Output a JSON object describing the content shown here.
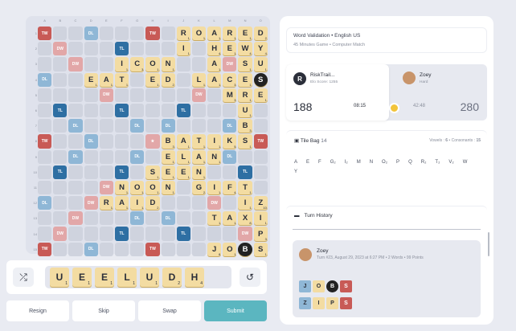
{
  "board": {
    "columns": [
      "A",
      "B",
      "C",
      "D",
      "E",
      "F",
      "G",
      "H",
      "I",
      "J",
      "K",
      "L",
      "M",
      "N",
      "O"
    ],
    "rows": [
      "1",
      "2",
      "3",
      "4",
      "5",
      "6",
      "7",
      "8",
      "9",
      "10",
      "11",
      "12",
      "13",
      "14",
      "15"
    ],
    "premium_labels": {
      "tw": "TW",
      "dw": "DW",
      "tl": "TL",
      "dl": "DL"
    },
    "tiles": [
      {
        "r": 0,
        "c": 9,
        "l": "R",
        "p": "1"
      },
      {
        "r": 0,
        "c": 10,
        "l": "O",
        "p": "1"
      },
      {
        "r": 0,
        "c": 11,
        "l": "A",
        "p": "1"
      },
      {
        "r": 0,
        "c": 12,
        "l": "R",
        "p": "1"
      },
      {
        "r": 0,
        "c": 13,
        "l": "E",
        "p": "1"
      },
      {
        "r": 0,
        "c": 14,
        "l": "D",
        "p": "2"
      },
      {
        "r": 1,
        "c": 9,
        "l": "I",
        "p": "1"
      },
      {
        "r": 1,
        "c": 11,
        "l": "H",
        "p": "4"
      },
      {
        "r": 1,
        "c": 12,
        "l": "E",
        "p": "1"
      },
      {
        "r": 1,
        "c": 13,
        "l": "W",
        "p": "4"
      },
      {
        "r": 1,
        "c": 14,
        "l": "Y",
        "p": "4"
      },
      {
        "r": 2,
        "c": 5,
        "l": "I",
        "p": "1"
      },
      {
        "r": 2,
        "c": 6,
        "l": "C",
        "p": "3"
      },
      {
        "r": 2,
        "c": 7,
        "l": "O",
        "p": "1"
      },
      {
        "r": 2,
        "c": 8,
        "l": "N",
        "p": "1"
      },
      {
        "r": 2,
        "c": 11,
        "l": "A",
        "p": "1"
      },
      {
        "r": 2,
        "c": 13,
        "l": "S",
        "p": "1"
      },
      {
        "r": 2,
        "c": 14,
        "l": "U",
        "p": "1"
      },
      {
        "r": 3,
        "c": 3,
        "l": "E",
        "p": "1"
      },
      {
        "r": 3,
        "c": 4,
        "l": "A",
        "p": "1"
      },
      {
        "r": 3,
        "c": 5,
        "l": "T",
        "p": "1"
      },
      {
        "r": 3,
        "c": 7,
        "l": "E",
        "p": "1"
      },
      {
        "r": 3,
        "c": 8,
        "l": "D",
        "p": "2"
      },
      {
        "r": 3,
        "c": 10,
        "l": "L",
        "p": "1"
      },
      {
        "r": 3,
        "c": 11,
        "l": "A",
        "p": "1"
      },
      {
        "r": 3,
        "c": 12,
        "l": "C",
        "p": "3"
      },
      {
        "r": 3,
        "c": 13,
        "l": "E",
        "p": "1"
      },
      {
        "r": 3,
        "c": 14,
        "l": "S",
        "p": "",
        "b": true
      },
      {
        "r": 4,
        "c": 12,
        "l": "M",
        "p": "3"
      },
      {
        "r": 4,
        "c": 13,
        "l": "R",
        "p": "1"
      },
      {
        "r": 4,
        "c": 14,
        "l": "E",
        "p": "1"
      },
      {
        "r": 5,
        "c": 13,
        "l": "U",
        "p": "1"
      },
      {
        "r": 6,
        "c": 13,
        "l": "B",
        "p": "3"
      },
      {
        "r": 7,
        "c": 8,
        "l": "B",
        "p": "3"
      },
      {
        "r": 7,
        "c": 9,
        "l": "A",
        "p": "1"
      },
      {
        "r": 7,
        "c": 10,
        "l": "T",
        "p": "1"
      },
      {
        "r": 7,
        "c": 11,
        "l": "I",
        "p": "1"
      },
      {
        "r": 7,
        "c": 12,
        "l": "K",
        "p": "5"
      },
      {
        "r": 7,
        "c": 13,
        "l": "S",
        "p": "1"
      },
      {
        "r": 8,
        "c": 8,
        "l": "E",
        "p": "1"
      },
      {
        "r": 8,
        "c": 9,
        "l": "L",
        "p": "1"
      },
      {
        "r": 8,
        "c": 10,
        "l": "A",
        "p": "1"
      },
      {
        "r": 8,
        "c": 11,
        "l": "N",
        "p": "1"
      },
      {
        "r": 9,
        "c": 7,
        "l": "S",
        "p": "1"
      },
      {
        "r": 9,
        "c": 8,
        "l": "E",
        "p": "1"
      },
      {
        "r": 9,
        "c": 9,
        "l": "E",
        "p": "1"
      },
      {
        "r": 9,
        "c": 10,
        "l": "N",
        "p": "1"
      },
      {
        "r": 10,
        "c": 5,
        "l": "N",
        "p": "1"
      },
      {
        "r": 10,
        "c": 6,
        "l": "O",
        "p": "1"
      },
      {
        "r": 10,
        "c": 7,
        "l": "O",
        "p": "1"
      },
      {
        "r": 10,
        "c": 8,
        "l": "N",
        "p": "1"
      },
      {
        "r": 10,
        "c": 10,
        "l": "G",
        "p": "2"
      },
      {
        "r": 10,
        "c": 11,
        "l": "I",
        "p": "1"
      },
      {
        "r": 10,
        "c": 12,
        "l": "F",
        "p": "4"
      },
      {
        "r": 10,
        "c": 13,
        "l": "T",
        "p": "1"
      },
      {
        "r": 11,
        "c": 4,
        "l": "R",
        "p": "1"
      },
      {
        "r": 11,
        "c": 5,
        "l": "A",
        "p": "1"
      },
      {
        "r": 11,
        "c": 6,
        "l": "I",
        "p": "1"
      },
      {
        "r": 11,
        "c": 7,
        "l": "D",
        "p": "2"
      },
      {
        "r": 11,
        "c": 13,
        "l": "I",
        "p": "1"
      },
      {
        "r": 11,
        "c": 14,
        "l": "Z",
        "p": "10"
      },
      {
        "r": 12,
        "c": 11,
        "l": "T",
        "p": "1"
      },
      {
        "r": 12,
        "c": 12,
        "l": "A",
        "p": "1"
      },
      {
        "r": 12,
        "c": 13,
        "l": "X",
        "p": "8"
      },
      {
        "r": 12,
        "c": 14,
        "l": "I",
        "p": "1"
      },
      {
        "r": 13,
        "c": 14,
        "l": "P",
        "p": "3"
      },
      {
        "r": 14,
        "c": 11,
        "l": "J",
        "p": "8"
      },
      {
        "r": 14,
        "c": 12,
        "l": "O",
        "p": "1"
      },
      {
        "r": 14,
        "c": 13,
        "l": "B",
        "p": "",
        "b": true
      },
      {
        "r": 14,
        "c": 14,
        "l": "S",
        "p": "1"
      }
    ]
  },
  "rack": {
    "tiles": [
      {
        "l": "U",
        "p": "1"
      },
      {
        "l": "E",
        "p": "1"
      },
      {
        "l": "E",
        "p": "1"
      },
      {
        "l": "L",
        "p": "1"
      },
      {
        "l": "U",
        "p": "1"
      },
      {
        "l": "D",
        "p": "2"
      },
      {
        "l": "H",
        "p": "4"
      }
    ],
    "shuffle_icon": "shuffle-icon",
    "undo_icon": "undo-icon"
  },
  "actions": {
    "resign": "Resign",
    "skip": "Skip",
    "swap": "Swap",
    "submit": "Submit"
  },
  "info": {
    "line1": "Word Validation • English US",
    "line2": "45 Minutes Game • Computer Match"
  },
  "player1": {
    "initial": "R",
    "name": "RiskTrail...",
    "elo": "Elo Score: 1255",
    "score": "188",
    "time": "08:15"
  },
  "player2": {
    "name": "Zoey",
    "level": "Hard",
    "time": "42:48",
    "score": "280"
  },
  "bag": {
    "title": "Tile Bag",
    "count": "14",
    "vowels_label": "Vowels :",
    "vowels": "6",
    "consonants_label": "Consonants :",
    "consonants": "15",
    "letters": [
      "A",
      "E",
      "F",
      "G₂",
      "I₂",
      "M",
      "N",
      "O₂",
      "P",
      "Q",
      "R₂",
      "T₂",
      "V₂",
      "W",
      "Y"
    ]
  },
  "history": {
    "title": "Turn History",
    "entry": {
      "name": "Zoey",
      "meta": "Turn #23, August 29, 2023 at 6:27 PM • 2 Words • 99 Points",
      "word1": [
        "J",
        "O",
        "B",
        "S"
      ],
      "word2": [
        "Z",
        "I",
        "P",
        "S"
      ]
    }
  },
  "colors": {
    "tile": "#f3dca2",
    "tw": "#c85a56",
    "dw": "#e2a7a8",
    "tl": "#2e6fa3",
    "dl": "#8fb7d6",
    "submit": "#5bb6c0",
    "turn": "#f2c43a"
  }
}
